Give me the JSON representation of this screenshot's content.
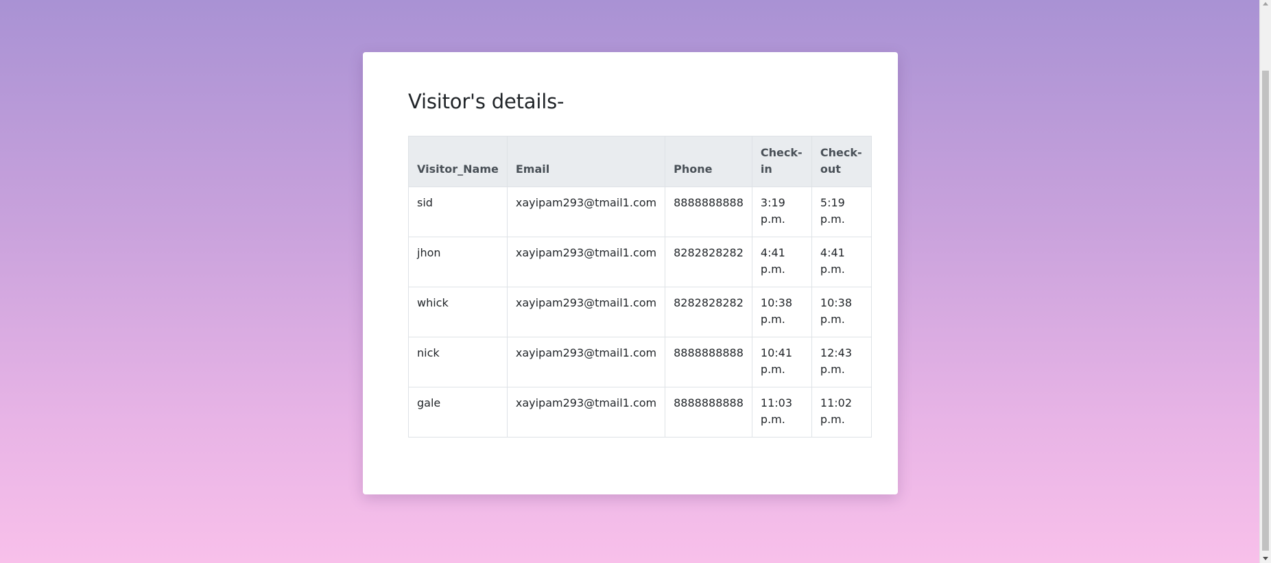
{
  "page": {
    "title": "Visitor's details-"
  },
  "table": {
    "headers": {
      "name": "Visitor_Name",
      "email": "Email",
      "phone": "Phone",
      "checkin": "Check-in",
      "checkout": "Check-out"
    },
    "rows": [
      {
        "name": "sid",
        "email": "xayipam293@tmail1.com",
        "phone": "8888888888",
        "checkin": "3:19 p.m.",
        "checkout": "5:19 p.m."
      },
      {
        "name": "jhon",
        "email": "xayipam293@tmail1.com",
        "phone": "8282828282",
        "checkin": "4:41 p.m.",
        "checkout": "4:41 p.m."
      },
      {
        "name": "whick",
        "email": "xayipam293@tmail1.com",
        "phone": "8282828282",
        "checkin": "10:38 p.m.",
        "checkout": "10:38 p.m."
      },
      {
        "name": "nick",
        "email": "xayipam293@tmail1.com",
        "phone": "8888888888",
        "checkin": "10:41 p.m.",
        "checkout": "12:43 p.m."
      },
      {
        "name": "gale",
        "email": "xayipam293@tmail1.com",
        "phone": "8888888888",
        "checkin": "11:03 p.m.",
        "checkout": "11:02 p.m."
      }
    ]
  },
  "colors": {
    "background_top": "#a992d4",
    "background_bottom": "#f8c0ea",
    "header_bg": "#e9ecef",
    "border": "#dee2e6"
  },
  "icons": {
    "scroll_up": "scroll-up-arrow-icon",
    "scroll_down": "scroll-down-arrow-icon"
  }
}
